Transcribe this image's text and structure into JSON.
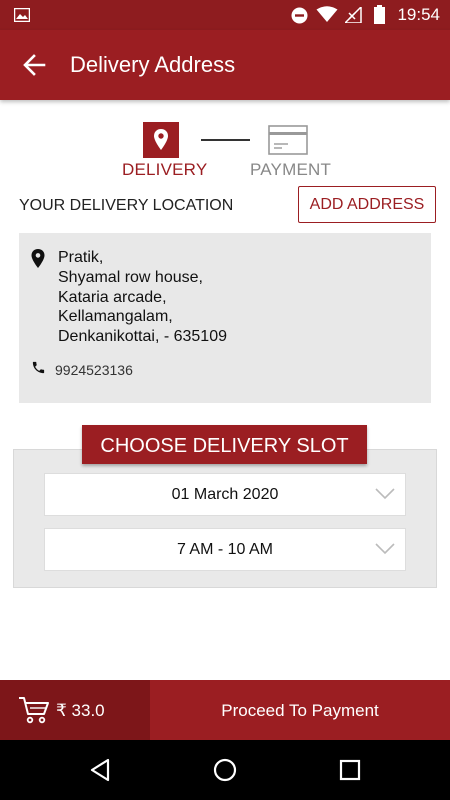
{
  "status_bar": {
    "time": "19:54"
  },
  "app_bar": {
    "title": "Delivery Address"
  },
  "stepper": {
    "steps": [
      {
        "label": "DELIVERY",
        "active": true
      },
      {
        "label": "PAYMENT",
        "active": false
      }
    ]
  },
  "location": {
    "title": "YOUR DELIVERY LOCATION",
    "add_address_label": "ADD ADDRESS"
  },
  "address": {
    "lines": [
      "Pratik,",
      "Shyamal row house,",
      "Kataria arcade,",
      "Kellamangalam,",
      "Denkanikottai, - 635109"
    ],
    "phone": "9924523136"
  },
  "slot": {
    "header": "CHOOSE DELIVERY SLOT",
    "date": "01 March 2020",
    "time": "7 AM - 10 AM"
  },
  "bottom_bar": {
    "cart_total": "₹ 33.0",
    "proceed_label": "Proceed To Payment"
  },
  "colors": {
    "brand": "#9b1e22",
    "brand_dark": "#7d1619",
    "status_bar": "#8e1c1f"
  }
}
